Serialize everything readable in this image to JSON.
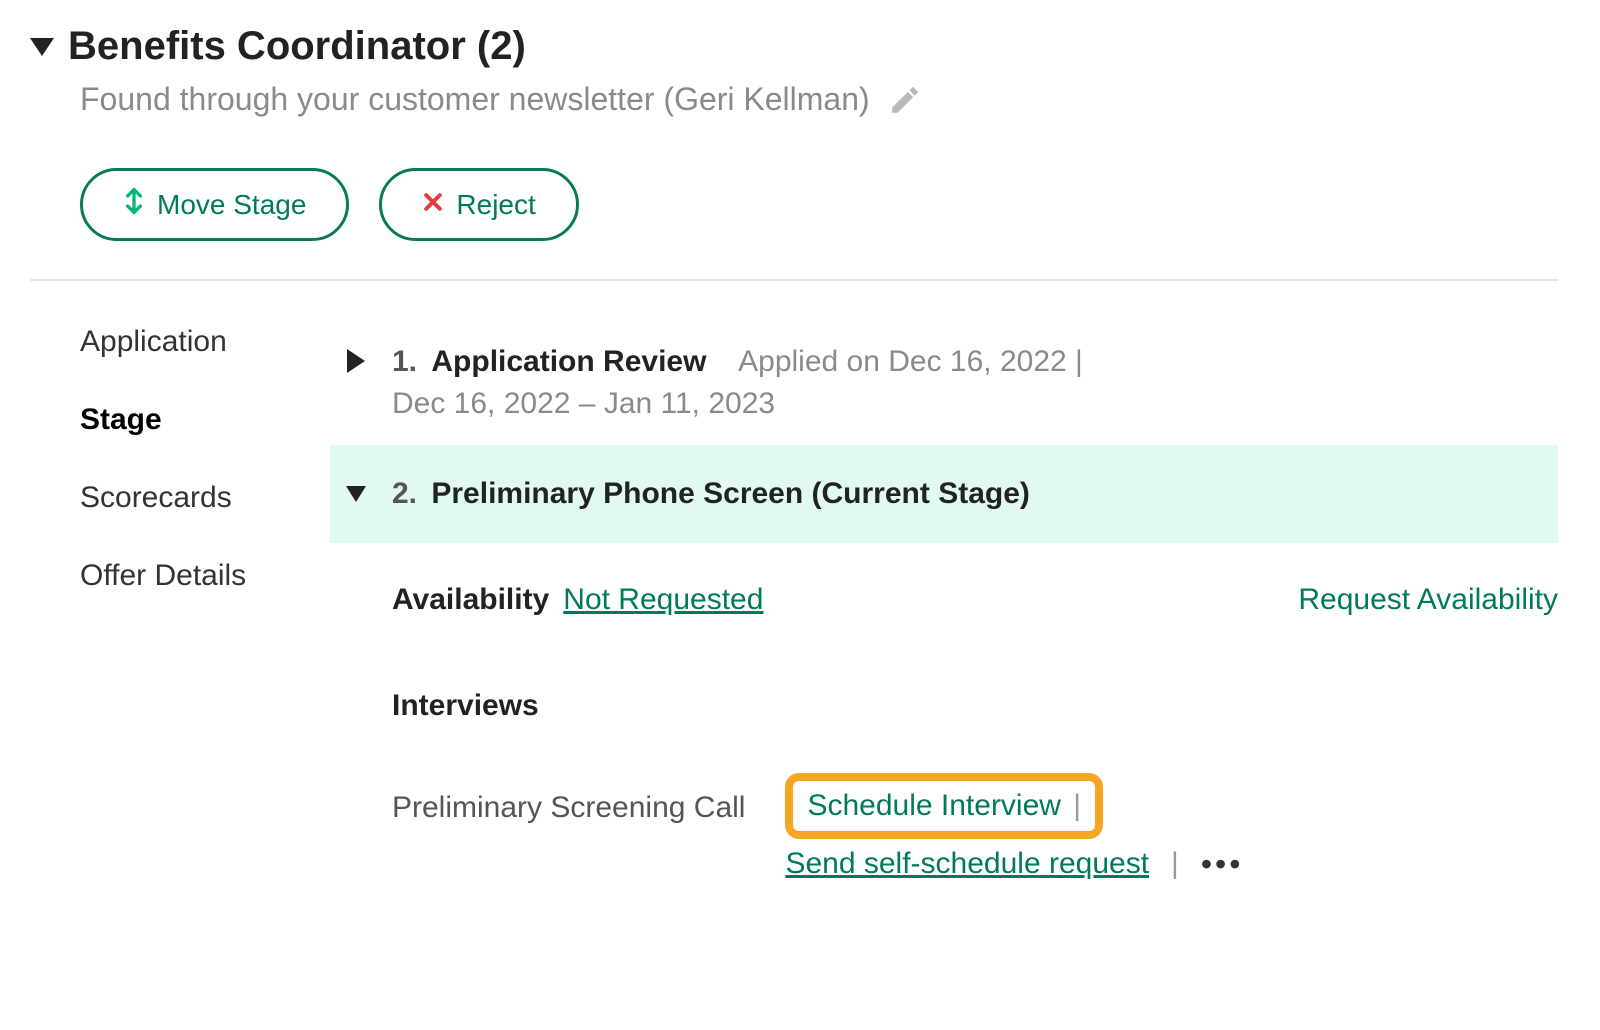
{
  "header": {
    "title": "Benefits Coordinator (2)",
    "subtitle": "Found through your customer newsletter (Geri Kellman)"
  },
  "actions": {
    "move_stage": "Move Stage",
    "reject": "Reject"
  },
  "sidenav": {
    "application": "Application",
    "stage": "Stage",
    "scorecards": "Scorecards",
    "offer_details": "Offer Details"
  },
  "stages": {
    "s1_num": "1.",
    "s1_name": "Application Review",
    "s1_applied": "Applied on Dec 16, 2022 |",
    "s1_range": "Dec 16, 2022 – Jan 11, 2023",
    "s2_num": "2.",
    "s2_name": "Preliminary Phone Screen (Current Stage)"
  },
  "availability": {
    "label": "Availability",
    "status": "Not Requested",
    "request": "Request Availability"
  },
  "interviews": {
    "heading": "Interviews",
    "name": "Preliminary Screening Call",
    "schedule": "Schedule Interview",
    "self_schedule": "Send self-schedule request"
  }
}
